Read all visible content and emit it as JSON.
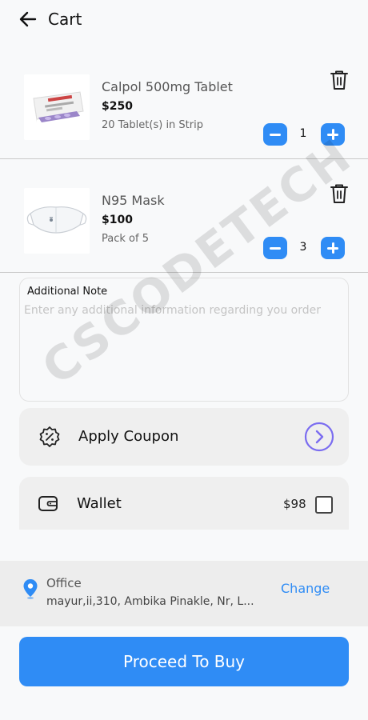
{
  "header": {
    "title": "Cart",
    "back_icon": "arrow-left-icon"
  },
  "cart_items": [
    {
      "name": "Calpol 500mg Tablet",
      "price": "$250",
      "pack": "20 Tablet(s) in Strip",
      "quantity": "1",
      "image": "medicine-box-image"
    },
    {
      "name": "N95 Mask",
      "price": "$100",
      "pack": "Pack of 5",
      "quantity": "3",
      "image": "mask-image"
    }
  ],
  "note": {
    "label": "Additional Note",
    "placeholder": "Enter any additional information regarding you order",
    "value": ""
  },
  "coupon": {
    "label": "Apply Coupon",
    "icon": "discount-badge-icon",
    "arrow_icon": "chevron-right-circle-icon"
  },
  "wallet": {
    "label": "Wallet",
    "amount": "$98",
    "checked": false,
    "icon": "wallet-icon"
  },
  "address": {
    "title": "Office",
    "line": "mayur,ii,310, Ambika Pinakle, Nr, L...",
    "change_label": "Change"
  },
  "footer": {
    "proceed_label": "Proceed To Buy"
  },
  "watermark": "CSCODETECH",
  "colors": {
    "accent": "#2f8cf5",
    "coupon_arrow": "#7a6cf0",
    "background": "#f8f9fa"
  }
}
